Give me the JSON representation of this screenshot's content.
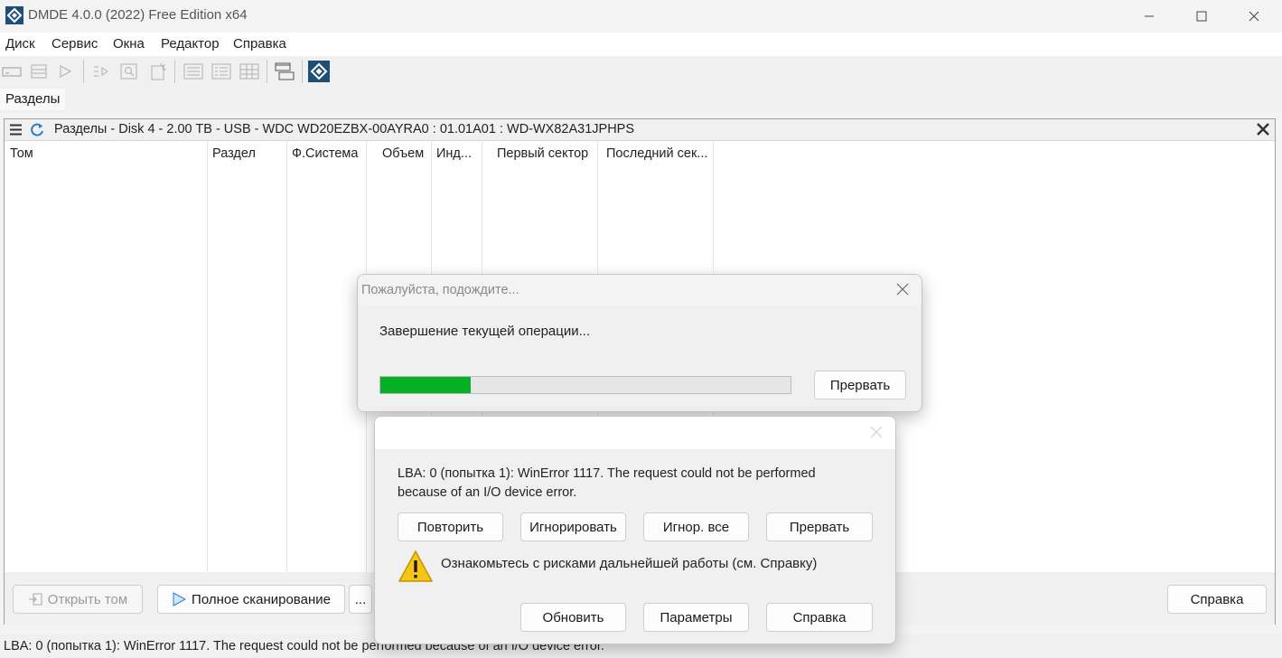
{
  "window": {
    "title": "DMDE 4.0.0 (2022) Free Edition x64",
    "controls": [
      "minimize-icon",
      "maximize-icon",
      "close-icon"
    ]
  },
  "menu": {
    "items": [
      "Диск",
      "Сервис",
      "Окна",
      "Редактор",
      "Справка"
    ]
  },
  "toolbar": {
    "icons": [
      "open-disk-icon",
      "partitions-icon",
      "play-icon",
      "go-to-icon",
      "search-icon",
      "new-file-icon",
      "view-text-icon",
      "view-list-icon",
      "view-grid-icon",
      "windows-icon",
      "dmde-logo-icon"
    ]
  },
  "tab": {
    "label": "Разделы"
  },
  "panel": {
    "title": "Разделы - Disk 4 - 2.00 TB - USB - WDC WD20EZBX-00AYRA0 : 01.01A01 : WD-WX82A31JPHPS",
    "columns": [
      "Том",
      "Раздел",
      "Ф.Система",
      "Объем",
      "Инд...",
      "Первый сектор",
      "Последний сек..."
    ],
    "buttons": {
      "open_volume": "Открыть том",
      "full_scan": "Полное сканирование",
      "more": "...",
      "help": "Справка"
    }
  },
  "status_bar": {
    "text": "LBA: 0 (попытка 1): WinError 1117. The request could not be performed because of an I/O device error."
  },
  "wait_dialog": {
    "title": "Пожалуйста, подождите...",
    "message": "Завершение текущей операции...",
    "progress": 0.22,
    "progress_color": "#06b025",
    "abort_button": "Прервать"
  },
  "error_dialog": {
    "message": "LBA: 0 (попытка 1): WinError 1117. The request could not be performed because of an I/O device error.",
    "buttons_row1": [
      "Повторить",
      "Игнорировать",
      "Игнор. все",
      "Прервать"
    ],
    "warning": "Ознакомьтесь с рисками дальнейшей работы (см. Справку)",
    "buttons_row2": [
      "Обновить",
      "Параметры",
      "Справка"
    ]
  },
  "colors": {
    "accent": "#1f4e79",
    "refresh_icon": "#2b7bd3",
    "warning_icon": "#f5c518"
  }
}
